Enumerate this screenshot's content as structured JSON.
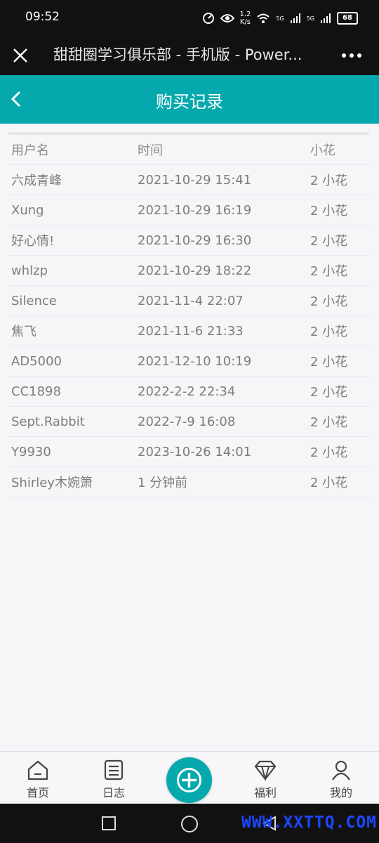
{
  "status": {
    "time": "09:52",
    "speed_top": "1.2",
    "speed_bottom": "K/s",
    "sig1": "5G",
    "sig2": "5G",
    "battery": "68"
  },
  "browser": {
    "title": "甜甜圈学习俱乐部 - 手机版 - Power..."
  },
  "header": {
    "title": "购买记录"
  },
  "table": {
    "columns": [
      "用户名",
      "时间",
      "小花"
    ],
    "rows": [
      [
        "六成青峰",
        "2021-10-29 15:41",
        "2 小花"
      ],
      [
        "Xung",
        "2021-10-29 16:19",
        "2 小花"
      ],
      [
        "好心情!",
        "2021-10-29 16:30",
        "2 小花"
      ],
      [
        "whlzp",
        "2021-10-29 18:22",
        "2 小花"
      ],
      [
        "Silence",
        "2021-11-4 22:07",
        "2 小花"
      ],
      [
        "焦飞",
        "2021-11-6 21:33",
        "2 小花"
      ],
      [
        "AD5000",
        "2021-12-10 10:19",
        "2 小花"
      ],
      [
        "CC1898",
        "2022-2-2 22:34",
        "2 小花"
      ],
      [
        "Sept.Rabbit",
        "2022-7-9 16:08",
        "2 小花"
      ],
      [
        "Y9930",
        "2023-10-26 14:01",
        "2 小花"
      ],
      [
        "Shirley木婉箫",
        "1 分钟前",
        "2 小花"
      ]
    ]
  },
  "nav": {
    "home": "首页",
    "journal": "日志",
    "welfare": "福利",
    "mine": "我的"
  },
  "watermark": "WWW.XXTTQ.COM",
  "colors": {
    "accent": "#05a8ad",
    "bar": "#111111",
    "watermark": "#1b47ff"
  }
}
